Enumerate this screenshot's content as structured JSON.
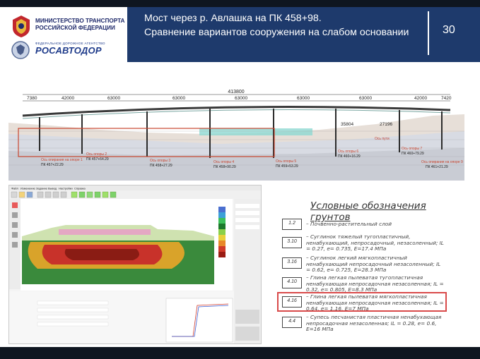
{
  "header": {
    "ministry_line1": "МИНИСТЕРСТВО ТРАНСПОРТА",
    "ministry_line2": "РОССИЙСКОЙ ФЕДЕРАЦИИ",
    "rosavtodor_sub": "ФЕДЕРАЛЬНОЕ ДОРОЖНОЕ АГЕНТСТВО",
    "rosavtodor_name": "РОСАВТОДОР",
    "title_line1": "Мост через р. Авлашка на ПК 458+98.",
    "title_line2": "Сравнение вариантов сооружения на слабом основании",
    "page_number": "30"
  },
  "profile": {
    "total_length": "413800",
    "spans": [
      "7380",
      "42000",
      "63000",
      "63000",
      "63000",
      "63000",
      "63000",
      "42000",
      "7420"
    ],
    "dims": [
      "35804",
      "27196"
    ],
    "supports": [
      {
        "label": "Ось опирания на опоре 1",
        "pk": "ПК 457+22.29"
      },
      {
        "label": "Ось опоры 2",
        "pk": "ПК 457+64.29"
      },
      {
        "label": "Ось опоры 3",
        "pk": "ПК 458+27.29"
      },
      {
        "label": "Ось опоры 4",
        "pk": "ПК 458+90.29"
      },
      {
        "label": "Ось опоры 5",
        "pk": "ПК 459+53.29"
      },
      {
        "label": "Ось опоры 6",
        "pk": "ПК 460+16.29"
      },
      {
        "label": "Ось опоры 7",
        "pk": "ПК 460+79.29"
      },
      {
        "label": "Ось опирания на опоре 9",
        "pk": "ПК 461+21.29"
      }
    ],
    "road_label": "Ось пути"
  },
  "software": {
    "menu": [
      "Файл",
      "Изменение",
      "Задание",
      "Вывод",
      "Настройки",
      "Справка"
    ]
  },
  "legend": {
    "title": "Условные обозначения грунтов",
    "items": [
      {
        "code": "1.2",
        "text": "– Почвенно-растительный слой"
      },
      {
        "code": "3.10",
        "text": "– Суглинок тяжелый тугопластичный, ненабухающий, непросадочный, незасоленный; IL = 0.27, e= 0.735, E=17.4 МПа"
      },
      {
        "code": "3.16",
        "text": "– Суглинок легкий мягкопластичный ненабухающий непросадочный незасоленный; IL = 0.62, e= 0.725, E=28.3 МПа"
      },
      {
        "code": "4.10",
        "text": "– Глина легкая пылеватая тугопластичная ненабухающая непросадочная незасоленная; IL = 0.32, e= 0.805, E=8.3 МПа"
      },
      {
        "code": "4.16",
        "text": "– Глина легкая пылеватая мягкопластичная ненабухающая непросадочная незасоленная; IL = 0.64, e= 1.16, E=7 МПа"
      },
      {
        "code": "4.4",
        "text": "– Супесь песчанистая пластичная ненабухающая непросадочная незасоленная; IL = 0.28, e= 0.6, E=16 МПа"
      }
    ]
  },
  "colors": {
    "title_panel": "#1e3a6c",
    "highlight": "#d94a4a",
    "profile_outline": "#c9452f"
  }
}
